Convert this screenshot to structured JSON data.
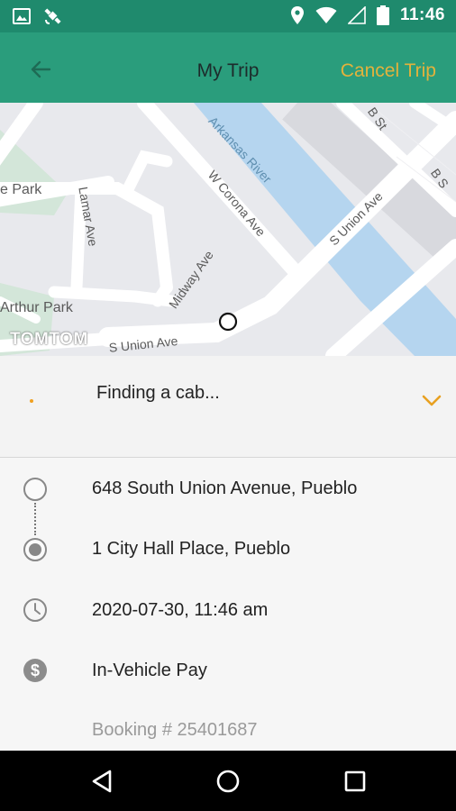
{
  "status_bar": {
    "time": "11:46",
    "icons": [
      "image-icon",
      "satellite-icon",
      "location-icon",
      "wifi-icon",
      "signal-icon",
      "battery-icon"
    ]
  },
  "app_bar": {
    "title": "My Trip",
    "cancel_label": "Cancel Trip",
    "back_icon": "arrow-left-icon"
  },
  "map": {
    "labels": {
      "arkansas_river": "Arkansas River",
      "w_corona": "W Corona Ave",
      "s_union": "S Union Ave",
      "s_union_bottom": "S Union Ave",
      "lamar": "Lamar Ave",
      "midway": "Midway Ave",
      "park_left": "e Park",
      "arthur_park": "Arthur Park",
      "b_st": "B St",
      "b_s": "B S"
    },
    "provider": "TOMTOM"
  },
  "trip_status": {
    "text": "Finding a cab...",
    "chevron_icon": "chevron-down-icon"
  },
  "trip_details": {
    "pickup": "648 South Union Avenue, Pueblo",
    "dropoff": "1 City Hall Place, Pueblo",
    "datetime": "2020-07-30, 11:46 am",
    "payment": "In-Vehicle Pay",
    "booking": "Booking # 25401687"
  },
  "nav_bar": {
    "icons": [
      "back-triangle-icon",
      "home-circle-icon",
      "recents-square-icon"
    ]
  },
  "colors": {
    "status_bar": "#1f8a6d",
    "app_bar": "#2a9d7c",
    "accent": "#e3b23c",
    "dot": "#f0a020"
  }
}
